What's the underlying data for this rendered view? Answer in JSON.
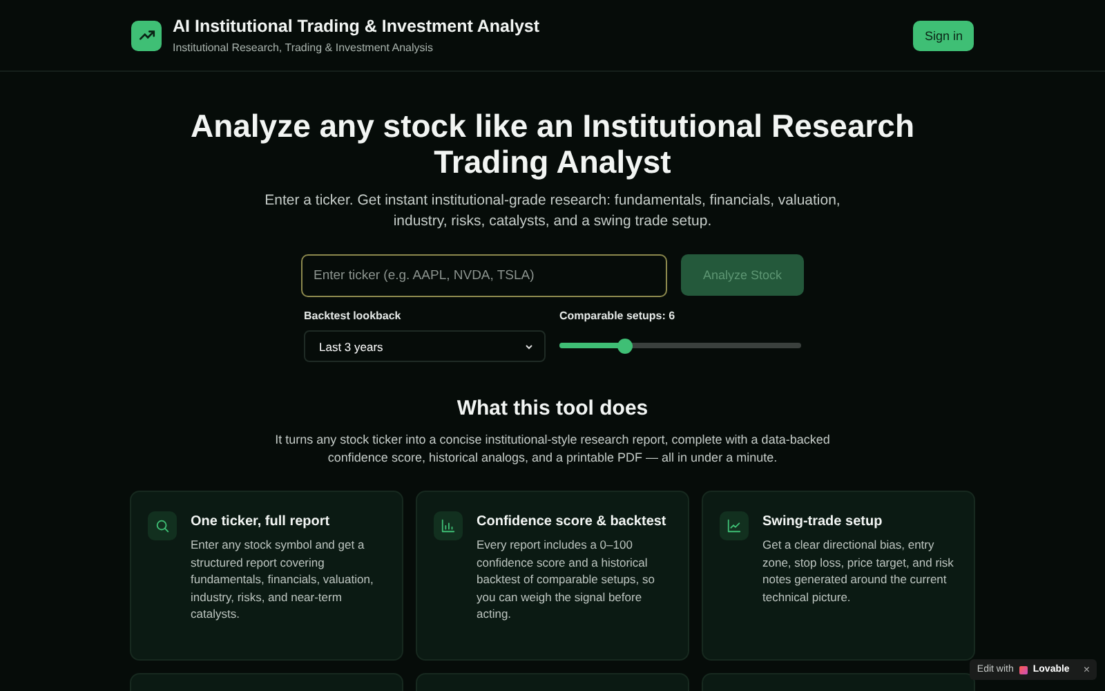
{
  "header": {
    "title": "AI Institutional Trading & Investment Analyst",
    "subtitle": "Institutional Research, Trading & Investment Analysis",
    "sign_in": "Sign in"
  },
  "hero": {
    "title": "Analyze any stock like an Institutional Research Trading Analyst",
    "description": "Enter a ticker. Get instant institutional-grade research: fundamentals, financials, valuation, industry, risks, catalysts, and a swing trade setup."
  },
  "search": {
    "placeholder": "Enter ticker (e.g. AAPL, NVDA, TSLA)",
    "button": "Analyze Stock"
  },
  "lookback": {
    "label": "Backtest lookback",
    "value": "Last 3 years"
  },
  "setups": {
    "label": "Comparable setups: 6",
    "level": 0.27
  },
  "about": {
    "title": "What this tool does",
    "description": "It turns any stock ticker into a concise institutional-style research report, complete with a data-backed confidence score, historical analogs, and a printable PDF — all in under a minute."
  },
  "features": [
    {
      "kind": "search",
      "title": "One ticker, full report",
      "text": "Enter any stock symbol and get a structured report covering fundamentals, financials, valuation, industry, risks, and near-term catalysts."
    },
    {
      "kind": "chart",
      "title": "Confidence score & backtest",
      "text": "Every report includes a 0–100 confidence score and a historical backtest of comparable setups, so you can weigh the signal before acting."
    },
    {
      "kind": "trend",
      "title": "Swing-trade setup",
      "text": "Get a clear directional bias, entry zone, stop loss, price target, and risk notes generated around the current technical picture."
    },
    {
      "kind": "blank"
    },
    {
      "kind": "blank"
    },
    {
      "kind": "blank"
    }
  ],
  "badge": {
    "prefix": "Edit with",
    "brand": "Lovable",
    "close": "×"
  }
}
